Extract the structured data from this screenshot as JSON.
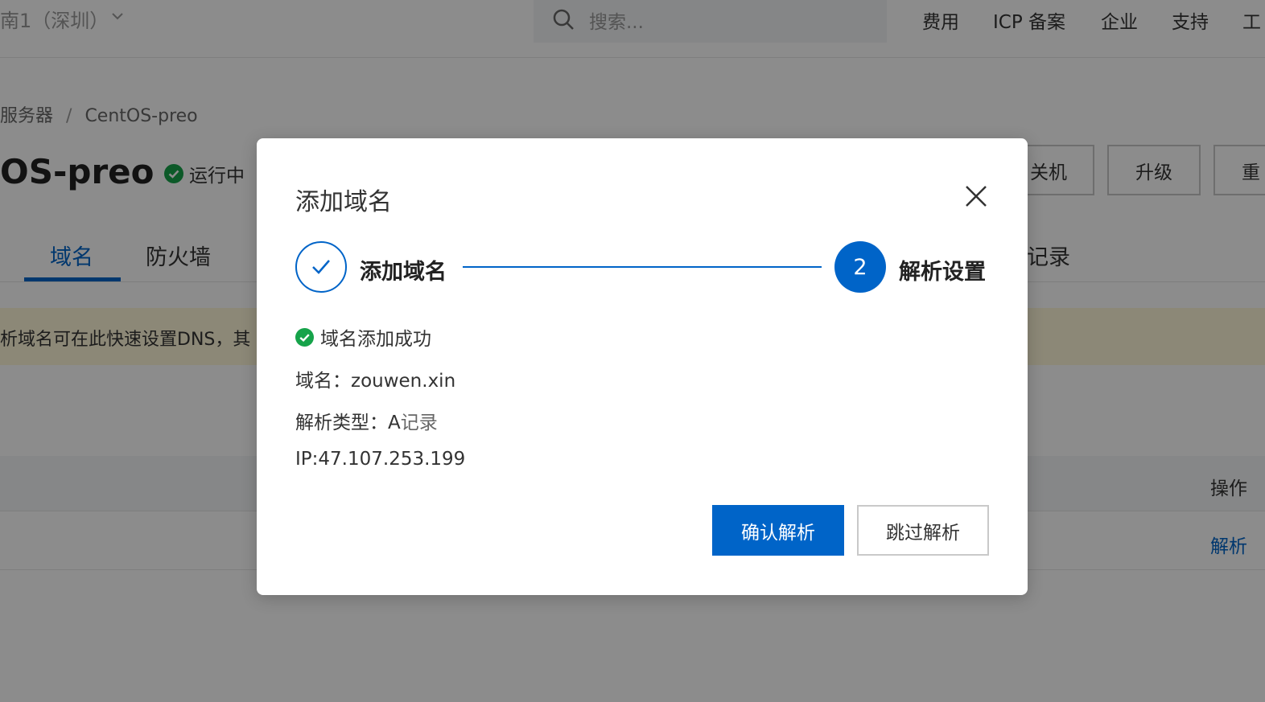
{
  "topbar": {
    "region": "南1（深圳）",
    "search_placeholder": "搜索...",
    "nav": [
      "费用",
      "ICP 备案",
      "企业",
      "支持",
      "工"
    ]
  },
  "breadcrumb": {
    "parent": "服务器",
    "separator": "/",
    "current": "CentOS-preo"
  },
  "server": {
    "title": "OS-preo",
    "status": "运行中",
    "actions": [
      "关机",
      "升级",
      "重"
    ]
  },
  "tabs": {
    "items": [
      "域名",
      "防火墙"
    ],
    "active": "域名",
    "right_partial": "记录"
  },
  "notice": {
    "text": "析域名可在此快速设置DNS，其"
  },
  "table": {
    "ops_header": "操作",
    "row_action": "解析"
  },
  "modal": {
    "title": "添加域名",
    "steps": [
      {
        "number": "1",
        "label": "添加域名",
        "state": "done"
      },
      {
        "number": "2",
        "label": "解析设置",
        "state": "active"
      }
    ],
    "success_text": "域名添加成功",
    "domain_label": "域名：",
    "domain_value": "zouwen.xin",
    "type_label": "解析类型：",
    "type_value_a": "A",
    "type_value_rest": "记录",
    "ip_text": "IP:47.107.253.199",
    "confirm_button": "确认解析",
    "skip_button": "跳过解析"
  },
  "colors": {
    "primary": "#0064c8",
    "success": "#16a34a",
    "notice_bg": "#fff7d9"
  },
  "icons": {
    "region_dropdown": "chevron-down-icon",
    "search": "search-icon",
    "status": "check-circle-icon",
    "close": "close-icon",
    "step_done": "check-icon",
    "success": "check-circle-icon"
  }
}
